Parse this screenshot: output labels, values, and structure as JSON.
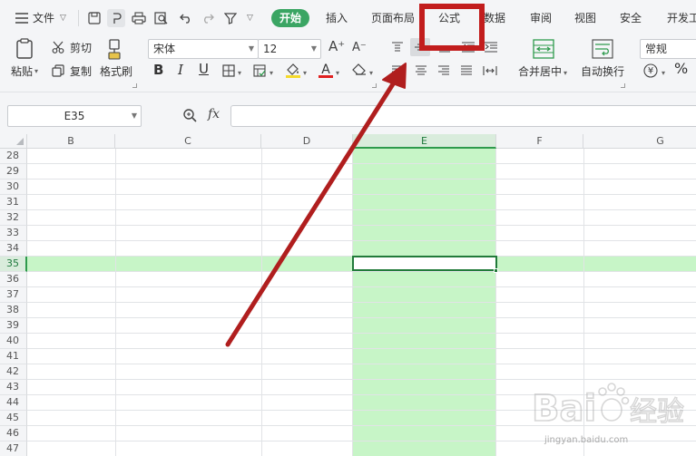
{
  "menu": {
    "hamburger_icon": "hamburger-icon",
    "file_label": "文件",
    "tabs": [
      "开始",
      "插入",
      "页面布局",
      "公式",
      "数据",
      "审阅",
      "视图",
      "安全",
      "开发工"
    ],
    "active_tab": "开始"
  },
  "ribbon": {
    "paste_label": "粘贴",
    "cut_label": "剪切",
    "copy_label": "复制",
    "format_painter_label": "格式刷",
    "font_name": "宋体",
    "font_size": "12",
    "merge_label": "合并居中",
    "wrap_label": "自动换行",
    "number_format": "常规",
    "bold": "B",
    "italic": "I",
    "underline": "U",
    "font_color_glyph": "A",
    "grow_font": "A⁺",
    "shrink_font": "A⁻",
    "currency_glyph": "¥",
    "percent_glyph": "%"
  },
  "formula_bar": {
    "name_box": "E35",
    "fx_label": "fx",
    "formula": ""
  },
  "grid": {
    "columns": [
      "B",
      "C",
      "D",
      "E",
      "F",
      "G"
    ],
    "selected_column": "E",
    "rows": [
      "28",
      "29",
      "30",
      "31",
      "32",
      "33",
      "34",
      "35",
      "36",
      "37",
      "38",
      "39",
      "40",
      "41",
      "42",
      "43",
      "44",
      "45",
      "46",
      "47"
    ],
    "selected_row": "35"
  },
  "annotation": {
    "highlight_color": "#c21d1d",
    "selection_color": "#c7f5c7"
  },
  "watermark": {
    "text": "Bai",
    "brand": "经验",
    "url": "jingyan.baidu.com"
  }
}
